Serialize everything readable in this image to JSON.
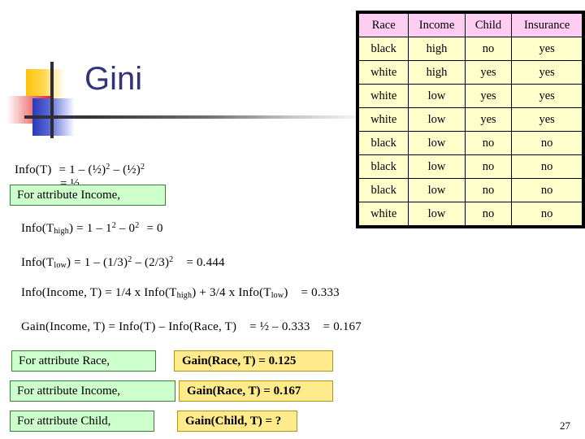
{
  "slide": {
    "title": "Gini",
    "page_number": "27",
    "accent_title_color": "#33337a",
    "logo_colors": {
      "yellow": "#FFC20E",
      "red": "#ED1C24",
      "blue": "#2B3BB5",
      "axis": "#2d2d38"
    }
  },
  "formulas": {
    "info_t_line1_a": "Info(T)",
    "info_t_line1_b": "= 1 – (½)",
    "info_t_line1_sup1": "2",
    "info_t_line1_c": " – (½)",
    "info_t_line1_sup2": "2",
    "info_t_line2": "= ½",
    "info_high_a": "Info(T",
    "info_high_sub": "high",
    "info_high_b": ") = 1 – 1",
    "info_high_sup1": "2",
    "info_high_c": " – 0",
    "info_high_sup2": "2",
    "info_high_d": "= 0",
    "info_low_a": "Info(T",
    "info_low_sub": "low",
    "info_low_b": ") = 1 – (1/3)",
    "info_low_sup1": "2",
    "info_low_c": " – (2/3)",
    "info_low_sup2": "2",
    "info_low_d": "= 0.444",
    "info_income_a": "Info(Income, T) = 1/4 x Info(T",
    "info_income_sub1": "high",
    "info_income_b": ") + 3/4 x Info(T",
    "info_income_sub2": "low",
    "info_income_c": ")",
    "info_income_d": "= 0.333",
    "gain_income_a": "Gain(Income, T) = Info(T) – Info(Race, T)",
    "gain_income_b": "= ½  – 0.333",
    "gain_income_c": "= 0.167"
  },
  "callouts": {
    "green_boxes": [
      {
        "label": "For attribute Income,"
      },
      {
        "label": "For attribute Race,"
      },
      {
        "label": "For attribute Income,"
      },
      {
        "label": "For attribute Child,"
      }
    ],
    "yellow_boxes": [
      {
        "label": "Gain(Race, T) = 0.125"
      },
      {
        "label": "Gain(Race, T) = 0.167"
      },
      {
        "label": "Gain(Child, T) = ?"
      }
    ],
    "green_fill": "#ccffcc",
    "green_border": "#3c7d3c",
    "yellow_fill": "#ffeb8c",
    "yellow_border": "#b3930f"
  },
  "table": {
    "header_fill": "#ffccf2",
    "body_fill": "#ffffcc",
    "columns": [
      "Race",
      "Income",
      "Child",
      "Insurance"
    ],
    "rows": [
      [
        "black",
        "high",
        "no",
        "yes"
      ],
      [
        "white",
        "high",
        "yes",
        "yes"
      ],
      [
        "white",
        "low",
        "yes",
        "yes"
      ],
      [
        "white",
        "low",
        "yes",
        "yes"
      ],
      [
        "black",
        "low",
        "no",
        "no"
      ],
      [
        "black",
        "low",
        "no",
        "no"
      ],
      [
        "black",
        "low",
        "no",
        "no"
      ],
      [
        "white",
        "low",
        "no",
        "no"
      ]
    ]
  }
}
